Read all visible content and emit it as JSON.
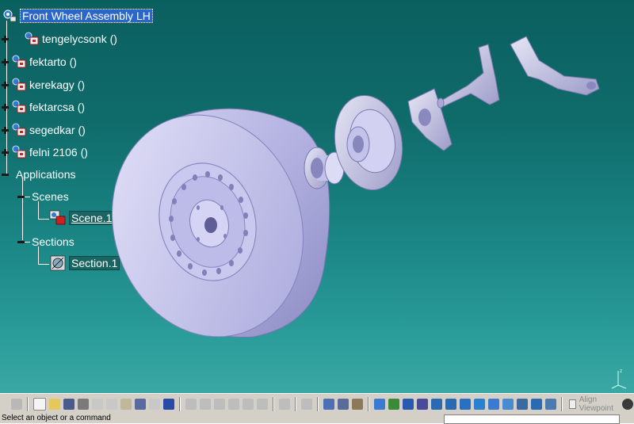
{
  "tree": {
    "root": {
      "label": "Front Wheel Assembly LH"
    },
    "parts": [
      {
        "label": "tengelycsonk ()"
      },
      {
        "label": "fektarto ()"
      },
      {
        "label": "kerekagy ()"
      },
      {
        "label": "fektarcsa ()"
      },
      {
        "label": "segedkar ()"
      },
      {
        "label": "felni 2106 ()"
      }
    ],
    "applications": {
      "label": "Applications"
    },
    "scenes": {
      "label": "Scenes",
      "child": "Scene.1"
    },
    "sections": {
      "label": "Sections",
      "child": "Section.1"
    }
  },
  "toolbar": {
    "align_viewpoint_label": "Align Viewpoint"
  },
  "status": {
    "prompt": "Select an object or a command"
  },
  "colors": {
    "background_top": "#0b5f5f",
    "background_bottom": "#3aa8a4",
    "selection": "#2b67c9",
    "part_surface": "#b7b6e6"
  }
}
